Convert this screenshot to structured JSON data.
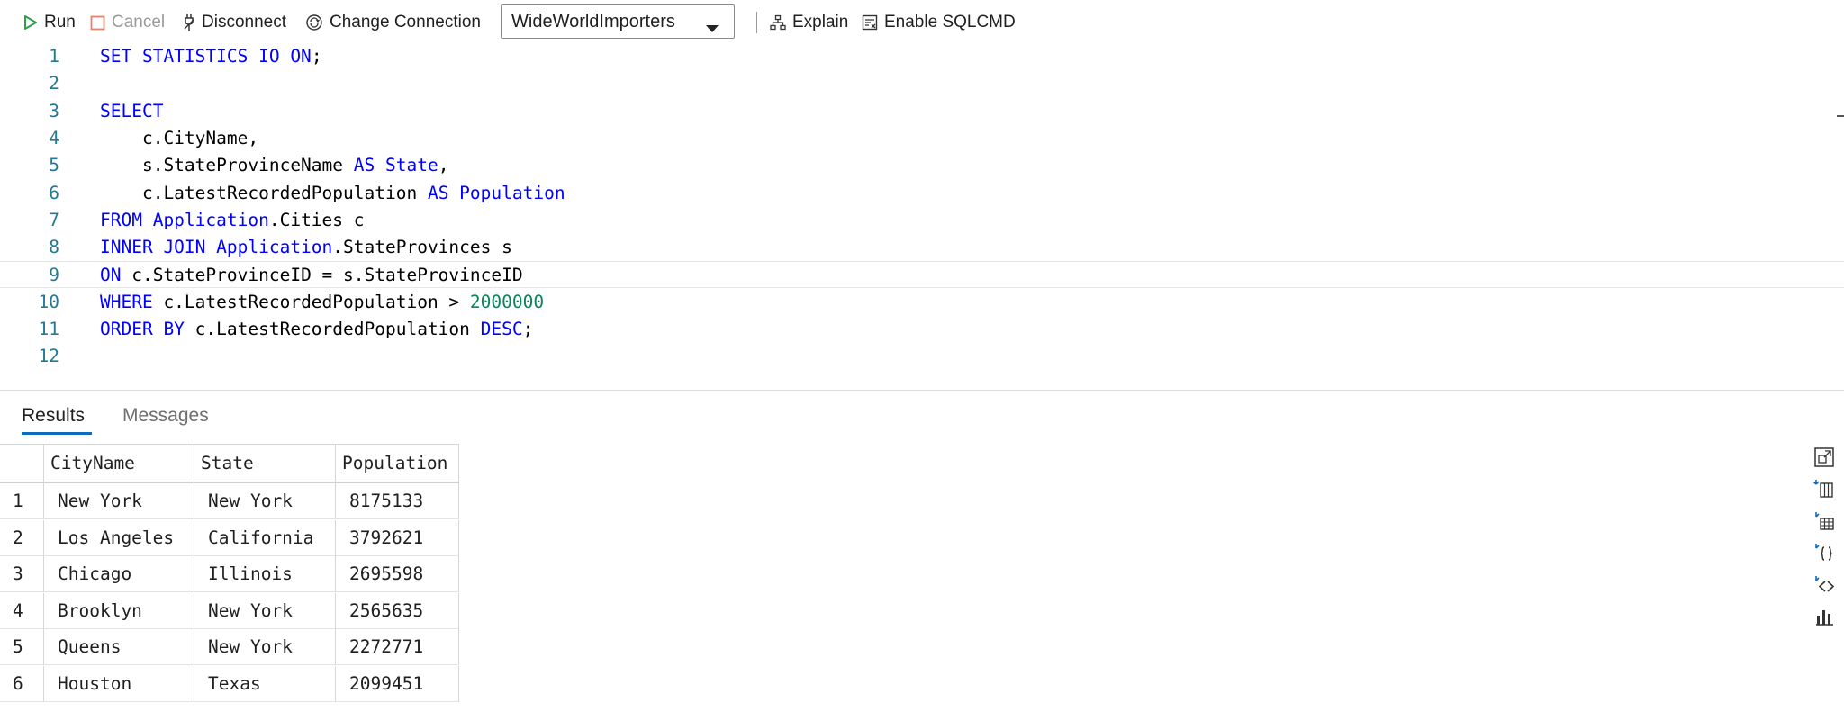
{
  "toolbar": {
    "run_label": "Run",
    "cancel_label": "Cancel",
    "disconnect_label": "Disconnect",
    "change_connection_label": "Change Connection",
    "database": "WideWorldImporters",
    "explain_label": "Explain",
    "sqlcmd_label": "Enable SQLCMD"
  },
  "editor": {
    "current_line": 9,
    "lines": [
      [
        {
          "t": "SET STATISTICS IO ON",
          "c": "kw"
        },
        {
          "t": ";",
          "c": ""
        }
      ],
      [],
      [
        {
          "t": "SELECT",
          "c": "kw"
        }
      ],
      [
        {
          "t": "    c.CityName,",
          "c": ""
        }
      ],
      [
        {
          "t": "    s.StateProvinceName ",
          "c": ""
        },
        {
          "t": "AS State",
          "c": "kw"
        },
        {
          "t": ",",
          "c": ""
        }
      ],
      [
        {
          "t": "    c.LatestRecordedPopulation ",
          "c": ""
        },
        {
          "t": "AS Population",
          "c": "kw"
        }
      ],
      [
        {
          "t": "FROM Application",
          "c": "kw"
        },
        {
          "t": ".Cities c",
          "c": ""
        }
      ],
      [
        {
          "t": "INNER JOIN Application",
          "c": "kw"
        },
        {
          "t": ".StateProvinces s",
          "c": ""
        }
      ],
      [
        {
          "t": "ON",
          "c": "kw"
        },
        {
          "t": " c.StateProvinceID = s.StateProvinceID",
          "c": ""
        }
      ],
      [
        {
          "t": "WHERE",
          "c": "kw"
        },
        {
          "t": " c.LatestRecordedPopulation > ",
          "c": ""
        },
        {
          "t": "2000000",
          "c": "num"
        }
      ],
      [
        {
          "t": "ORDER BY",
          "c": "kw"
        },
        {
          "t": " c.LatestRecordedPopulation ",
          "c": ""
        },
        {
          "t": "DESC",
          "c": "kw"
        },
        {
          "t": ";",
          "c": ""
        }
      ],
      []
    ]
  },
  "results": {
    "tabs": [
      {
        "label": "Results",
        "active": true
      },
      {
        "label": "Messages",
        "active": false
      }
    ],
    "columns": [
      "CityName",
      "State",
      "Population"
    ],
    "rows": [
      [
        "New York",
        "New York",
        "8175133"
      ],
      [
        "Los Angeles",
        "California",
        "3792621"
      ],
      [
        "Chicago",
        "Illinois",
        "2695598"
      ],
      [
        "Brooklyn",
        "New York",
        "2565635"
      ],
      [
        "Queens",
        "New York",
        "2272771"
      ],
      [
        "Houston",
        "Texas",
        "2099451"
      ]
    ]
  },
  "side_actions": [
    "maximize-icon",
    "save-as-csv-icon",
    "save-as-excel-icon",
    "save-as-json-icon",
    "save-as-xml-icon",
    "chart-icon"
  ],
  "colors": {
    "keyword": "#0000ff",
    "number": "#098658",
    "line_number": "#237893",
    "accent": "#0f6cbd",
    "run_icon": "#2e9f4a",
    "cancel_icon": "#e3836b"
  }
}
